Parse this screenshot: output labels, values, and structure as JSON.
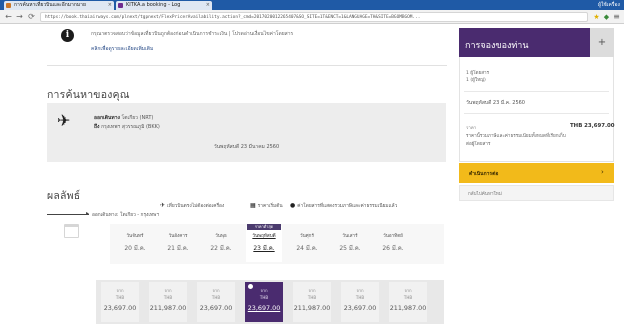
{
  "browser": {
    "tabs": [
      {
        "title": "การค้นหาเที่ยวบินและอีกมากมาย"
      },
      {
        "title": "KITKA.a booking - Log"
      }
    ],
    "window_controls": "ผู้ใช้เครื่อง",
    "url": "https://book.thaiairways.com/plnext/tgpnext/FlexPricerAvailability.action?_cmd=2017020012265407&SO_SITE=1T&ENCT=1&LANGUAGE=TH&SITE=BGOMBGOM...",
    "nav": {
      "back": "←",
      "forward": "→",
      "reload": "⟳",
      "menu": "≡"
    }
  },
  "info": {
    "line1": "กรุณาตรวจสอบว่าข้อมูลเที่ยวบินถูกต้องก่อนดำเนินการชำระเงิน | โปรดอ่านเงื่อนไขค่าโดยสาร",
    "line2": "คลิกเพื่อดูรายละเอียดเพิ่มเติม"
  },
  "search_section": {
    "title": "การค้นหาของคุณ",
    "flight_line1": {
      "label": "ออกเดินทาง",
      "value": "โตเกียว (NRT)"
    },
    "flight_line2": {
      "label": "ถึง",
      "value": "กรุงเทพฯ สุวรรณภูมิ (BKK)"
    },
    "total": "วันพฤหัสบดี 23 มีนาคม 2560"
  },
  "results_section": {
    "title": "ผลลัพธ์",
    "legend": [
      {
        "icon": "plane-icon",
        "text": "เที่ยวบินตรงไม่ต้องต่อเครื่อง"
      },
      {
        "icon": "calendar-icon",
        "text": "ราคาเริ่มต้น"
      },
      {
        "icon": "info-icon",
        "text": "ค่าโดยสารที่แสดงรวมภาษีและค่าธรรมเนียมแล้ว"
      }
    ],
    "route_label": "ออกเดินทาง: โตเกียว - กรุงเทพฯ",
    "dates": [
      {
        "dow": "วันจันทร์",
        "dm": "20 มี.ค."
      },
      {
        "dow": "วันอังคาร",
        "dm": "21 มี.ค."
      },
      {
        "dow": "วันพุธ",
        "dm": "22 มี.ค."
      },
      {
        "dow": "วันพฤหัสบดี",
        "dm": "23 มี.ค.",
        "selected": true,
        "badge": "ราคาต่ำสุด"
      },
      {
        "dow": "วันศุกร์",
        "dm": "24 มี.ค."
      },
      {
        "dow": "วันเสาร์",
        "dm": "25 มี.ค."
      },
      {
        "dow": "วันอาทิตย์",
        "dm": "26 มี.ค."
      }
    ],
    "prices": [
      {
        "cur": "จาก",
        "cur2": "THB",
        "amount": "23,697.00"
      },
      {
        "cur": "จาก",
        "cur2": "THB",
        "amount": "211,987.00"
      },
      {
        "cur": "จาก",
        "cur2": "THB",
        "amount": "23,697.00"
      },
      {
        "cur": "จาก",
        "cur2": "THB",
        "amount": "23,697.00",
        "selected": true
      },
      {
        "cur": "จาก",
        "cur2": "THB",
        "amount": "211,987.00"
      },
      {
        "cur": "จาก",
        "cur2": "THB",
        "amount": "23,697.00"
      },
      {
        "cur": "จาก",
        "cur2": "THB",
        "amount": "211,987.00"
      }
    ]
  },
  "sidebar": {
    "title": "การจองของท่าน",
    "plus": "+",
    "passengers": "1 ผู้โดยสาร",
    "class": "1 (ผู้ใหญ่)",
    "date": "วันพฤหัสบดี 23 มี.ค. 2560",
    "price_label": "ราคา",
    "price": "THB 23,697.00",
    "note1": "ราคานี้รวมภาษีและค่าธรรมเนียมทั้งหมดที่เรียกเก็บ",
    "note2": "ต่อผู้โดยสาร",
    "continue": "ดำเนินการต่อ",
    "continue_arrow": "›",
    "secondary": "กลับไปค้นหาใหม่"
  },
  "colors": {
    "brand_purple": "#4a2b6f",
    "accent_yellow": "#f2ba1a",
    "browser_blue": "#1f5aa6"
  }
}
